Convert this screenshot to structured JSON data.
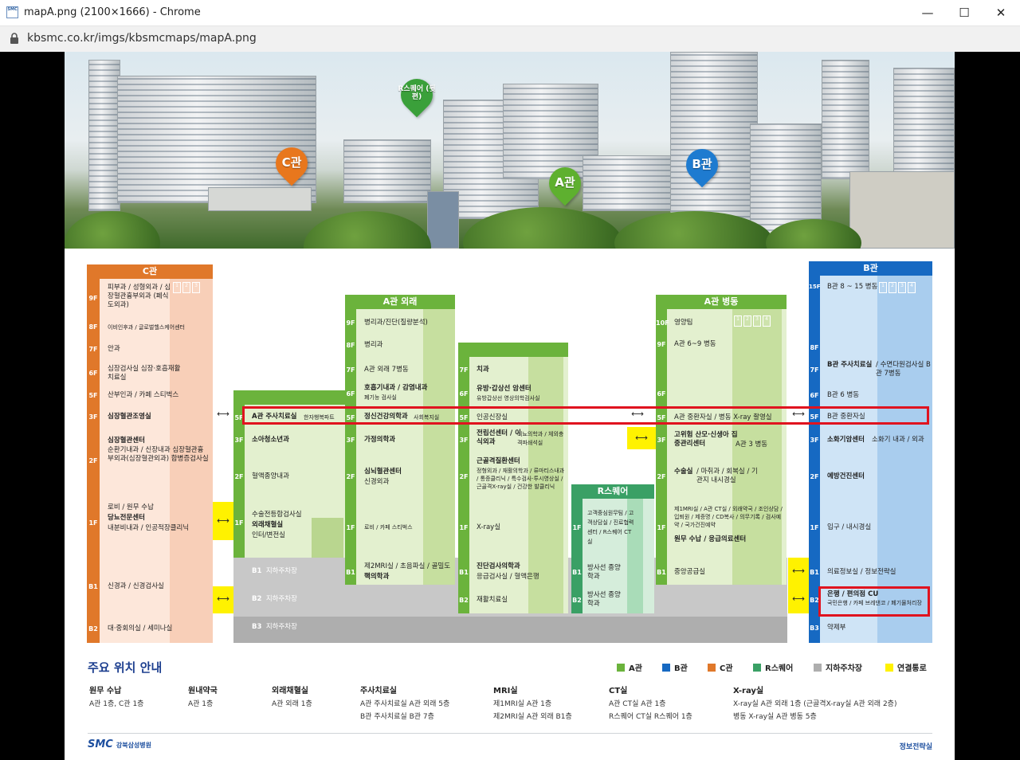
{
  "window": {
    "title": "mapA.png (2100×1666) - Chrome",
    "url": "kbsmc.co.kr/imgs/kbsmcmaps/mapA.png",
    "minimize": "—",
    "maximize": "☐",
    "close": "✕"
  },
  "photo": {
    "pins": [
      {
        "label": "C관",
        "color": "#e8771d"
      },
      {
        "label": "R스퀘어 (뒷편)",
        "color": "#3aa03a"
      },
      {
        "label": "A관",
        "color": "#5eb02f"
      },
      {
        "label": "B관",
        "color": "#1e7bd0"
      }
    ]
  },
  "colors": {
    "A": "#6bb33c",
    "B": "#1669c2",
    "C": "#e0782a",
    "R": "#3aa065",
    "P": "#aeaeae",
    "Y": "#fff200"
  },
  "c_building": {
    "header": "C관",
    "floors": [
      {
        "f": "9F",
        "text": "피부과 / 성형외과 / 심장혈관흉부외과 (폐식도외과)"
      },
      {
        "f": "8F",
        "text": "이비인후과 / 글로벌헬스케어센터"
      },
      {
        "f": "7F",
        "text": "안과"
      },
      {
        "f": "6F",
        "text": "심장검사실 심장·호흡재활치료실"
      },
      {
        "f": "5F",
        "text": "산부인과 / 카페 스티벅스"
      },
      {
        "f": "3F",
        "text": "심장혈관조영실"
      },
      {
        "f": "2F",
        "title": "심장혈관센터",
        "text": "순환기내과 / 신장내과 심장혈관흉부외과(심장혈관외과) 합병증검사실"
      },
      {
        "f": "1F",
        "title": "당뇨전문센터",
        "pre": "로비 / 원무 수납",
        "text": "내분비내과 / 인공적장클리닉"
      },
      {
        "f": "B1",
        "text": "신경과 / 신경검사실"
      },
      {
        "f": "B2",
        "text": "대·중회의실 / 세미나실"
      }
    ],
    "elevators": [
      "1",
      "2",
      "3"
    ]
  },
  "a_out": {
    "header": "A관 외래",
    "floors": [
      {
        "f": "9F",
        "text": "병리과/진단(질량분석)"
      },
      {
        "f": "8F",
        "text": "병리과"
      },
      {
        "f": "7F",
        "text": "A관 외래 7병동"
      },
      {
        "f": "6F",
        "title": "호흡기내과 / 감염내과",
        "text": "폐기능 검사실"
      },
      {
        "f": "5F",
        "title": "정신건강의학과",
        "text": "사회복지실"
      },
      {
        "f": "3F",
        "title": "가정의학과"
      },
      {
        "f": "2F",
        "title": "심뇌혈관센터",
        "text": "신경외과"
      },
      {
        "f": "1F",
        "text": "로비 / 카페 스티벅스"
      },
      {
        "f": "B1",
        "title": "핵의학과",
        "text": "제2MRI실 / 초음파실 / 골밀도"
      }
    ]
  },
  "a_left": {
    "floors": [
      {
        "f": "5F",
        "title": "A관 주사치료실",
        "text": "한자행복파트"
      },
      {
        "f": "3F",
        "title": "소아청소년과"
      },
      {
        "f": "2F",
        "text": "혈액종양내과"
      },
      {
        "f": "1F",
        "title": "외래채혈실",
        "pre": "수술전등합검사실",
        "text": "인터/변전실"
      }
    ]
  },
  "a_mid": {
    "floors": [
      {
        "f": "7F",
        "title": "치과"
      },
      {
        "f": "6F",
        "title": "유방·갑상선 암센터",
        "text": "유방갑상선 영상의학검사실"
      },
      {
        "f": "5F",
        "text": "인공신장실"
      },
      {
        "f": "3F",
        "title": "전립선센터 / 이식외과",
        "text": "비뇨의학과 / 체외충격파쇄석실"
      },
      {
        "f": "2F",
        "title": "근골격질환센터",
        "text": "정형외과 / 재활의학과 / 류마티스내과 / 통증클리닉 / 특수검사·투시영상실 / 근골격X-ray실 / 건강한 발클리닉"
      },
      {
        "f": "1F",
        "text": "X-ray실"
      },
      {
        "f": "B1",
        "title": "진단검사의학과",
        "text": "응급검사실 / 혈액은행"
      },
      {
        "f": "B2",
        "text": "재활치료실"
      }
    ]
  },
  "r_square": {
    "header": "R스퀘어",
    "floors": [
      {
        "f": "1F",
        "text": "고객중심원무팀 / 고객상담실 / 진료협력센터 / R스퀘어 CT실"
      },
      {
        "f": "B1",
        "text": "방사선 종양학과"
      },
      {
        "f": "B2",
        "text": "방사선 종양학과"
      }
    ]
  },
  "a_ward": {
    "header": "A관 병동",
    "floors": [
      {
        "f": "10F",
        "text": "영양팀"
      },
      {
        "f": "9F",
        "text": "A관 6~9 병동"
      },
      {
        "f": "6F",
        "text": ""
      },
      {
        "f": "5F",
        "text": "A관 중환자실 / 병동 X-ray 촬영실"
      },
      {
        "f": "3F",
        "title": "고위험 산모·신생아 집중관리센터",
        "text": "A관 3 병동"
      },
      {
        "f": "2F",
        "title": "수술실",
        "text": "/ 마취과 / 회복실 / 기관지 내시경실"
      },
      {
        "f": "1F",
        "title": "원무 수납 / 응급의료센터",
        "text": "제1MRI실 / A관 CT실 / 외래약국 / 조인상담 / 입퇴원 / 제증명 / CD복사 / 의무기록 / 검사예약 / 국가건진예약"
      },
      {
        "f": "B1",
        "text": "중앙공급실"
      }
    ],
    "elevators": [
      "1",
      "2",
      "3",
      "4"
    ]
  },
  "b_building": {
    "header": "B관",
    "floors": [
      {
        "f": "15F",
        "text": "B관 8 ~ 15 병동"
      },
      {
        "f": "8F",
        "text": ""
      },
      {
        "f": "7F",
        "title": "B관 주사치료실",
        "text": "/ 수면다원검사실 B관 7병동"
      },
      {
        "f": "6F",
        "text": "B관 6 병동"
      },
      {
        "f": "5F",
        "text": "B관 중환자실"
      },
      {
        "f": "3F",
        "title": "소화기암센터",
        "text": "소화기 내과 / 외과"
      },
      {
        "f": "2F",
        "title": "예방건진센터"
      },
      {
        "f": "1F",
        "text": "입구 / 내시경실"
      },
      {
        "f": "B1",
        "text": "의료정보실 / 정보전략실"
      },
      {
        "f": "B2",
        "title": "은행 / 편의점 CU",
        "text": "국민은행 / 카페 브레댄코 / 폐기물처리장"
      },
      {
        "f": "B3",
        "text": "약제부"
      }
    ],
    "elevators": [
      "1",
      "2",
      "3",
      "4"
    ]
  },
  "parking": {
    "b1": "지하주차장",
    "b2": "지하주차장",
    "b3": "지하주차장"
  },
  "legend": {
    "title": "주요 위치 안내",
    "items": [
      {
        "label": "A관",
        "color": "#6bb33c"
      },
      {
        "label": "B관",
        "color": "#1669c2"
      },
      {
        "label": "C관",
        "color": "#e0782a"
      },
      {
        "label": "R스퀘어",
        "color": "#3aa065"
      },
      {
        "label": "지하주차장",
        "color": "#aeaeae"
      },
      {
        "label": "연결통로",
        "color": "#fff200"
      }
    ]
  },
  "info": [
    {
      "title": "원무 수납",
      "lines": [
        "A관 1층, C관 1층"
      ]
    },
    {
      "title": "원내약국",
      "lines": [
        "A관 1층"
      ]
    },
    {
      "title": "외래채혈실",
      "lines": [
        "A관 외래 1층"
      ]
    },
    {
      "title": "주사치료실",
      "lines": [
        "A관 주사치료실  A관 외래 5층",
        "B관 주사치료실  B관 7층"
      ]
    },
    {
      "title": "MRI실",
      "lines": [
        "제1MRI실  A관 1층",
        "제2MRI실  A관 외래 B1층"
      ]
    },
    {
      "title": "CT실",
      "lines": [
        "A관 CT실  A관 1층",
        "R스퀘어 CT실  R스퀘어 1층"
      ]
    },
    {
      "title": "X-ray실",
      "lines": [
        "X-ray실  A관 외래 1층 (근골격X-ray실  A관 외래 2층)",
        "병동 X-ray실  A관 병동 5층"
      ]
    }
  ],
  "footer": {
    "logo": "SMC",
    "logo_sub": "강북삼성병원",
    "right": "정보전략실"
  }
}
